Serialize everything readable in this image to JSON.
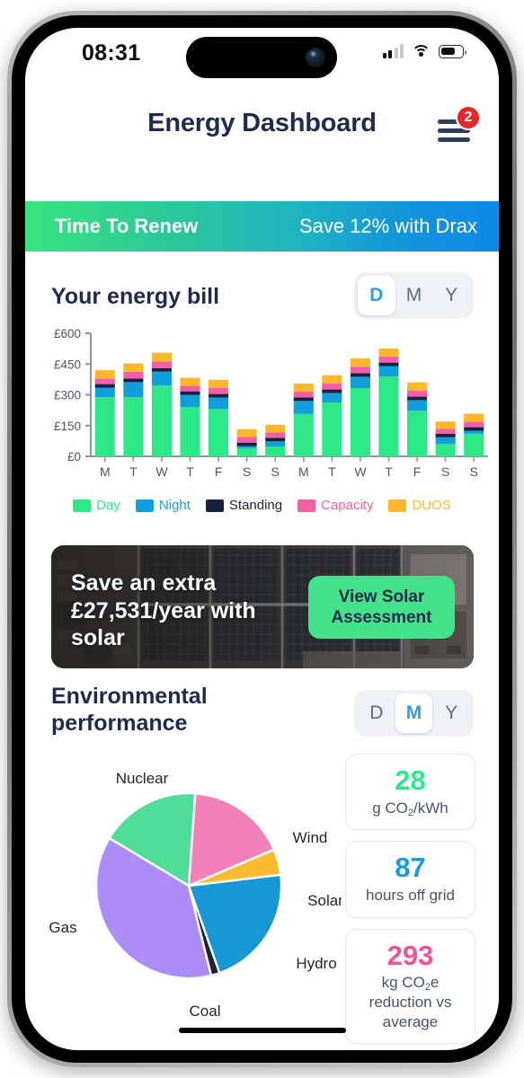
{
  "status_bar": {
    "time": "08:31",
    "signal_icon": "signal-bars-icon",
    "wifi_icon": "wifi-icon",
    "battery_icon": "battery-icon"
  },
  "header": {
    "title": "Energy Dashboard",
    "menu_icon": "hamburger-menu-icon",
    "notification_count": "2",
    "badge_color": "#e8262a"
  },
  "renew_banner": {
    "label": "Time To Renew",
    "offer": "Save 12% with Drax",
    "gradient_from": "#37e57e",
    "gradient_to": "#0c8ae6"
  },
  "bill_section": {
    "title": "Your energy bill",
    "toggle": {
      "options": [
        "D",
        "M",
        "Y"
      ],
      "selected": "D"
    }
  },
  "solar_promo": {
    "headline": "Save an extra £27,531/year with solar",
    "cta_label": "View Solar Assessment",
    "cta_color": "#44e38b"
  },
  "environment_section": {
    "title": "Environmental performance",
    "toggle": {
      "options": [
        "D",
        "M",
        "Y"
      ],
      "selected": "M"
    }
  },
  "metrics": [
    {
      "value": "28",
      "label": "g CO2/kWh",
      "label_pre": "g CO",
      "label_sub": "2",
      "label_post": "/kWh",
      "color": "#2ce887"
    },
    {
      "value": "87",
      "label": "hours off grid",
      "label_pre": "hours off grid",
      "label_sub": "",
      "label_post": "",
      "color": "#1a9ddb"
    },
    {
      "value": "293",
      "label": "kg CO2e reduction vs average",
      "label_pre": "kg CO",
      "label_sub": "2",
      "label_post": "e reduction vs average",
      "color": "#f2529b"
    }
  ],
  "chart_data": [
    {
      "type": "bar",
      "title": "Your energy bill",
      "stacked": true,
      "xlabel": "",
      "ylabel": "",
      "ylim": [
        0,
        600
      ],
      "yticks": [
        0,
        150,
        300,
        450,
        600
      ],
      "ytick_labels": [
        "£0",
        "£150",
        "£300",
        "£450",
        "£600"
      ],
      "grid": false,
      "legend_position": "bottom",
      "categories": [
        "M",
        "T",
        "W",
        "T",
        "F",
        "S",
        "S",
        "M",
        "T",
        "W",
        "T",
        "F",
        "S",
        "S"
      ],
      "series": [
        {
          "name": "Day",
          "color": "#2ce887",
          "values": [
            288,
            288,
            345,
            240,
            232,
            40,
            48,
            207,
            263,
            333,
            390,
            222,
            60,
            110
          ]
        },
        {
          "name": "Night",
          "color": "#119edb",
          "values": [
            47,
            74,
            68,
            60,
            55,
            10,
            25,
            63,
            46,
            55,
            50,
            52,
            33,
            15
          ]
        },
        {
          "name": "Standing",
          "color": "#17233c",
          "values": [
            17,
            17,
            17,
            17,
            17,
            17,
            17,
            17,
            17,
            17,
            17,
            17,
            17,
            17
          ]
        },
        {
          "name": "Capacity",
          "color": "#f65fa8",
          "values": [
            28,
            33,
            33,
            27,
            29,
            27,
            26,
            28,
            30,
            31,
            29,
            30,
            24,
            27
          ]
        },
        {
          "name": "DUOS",
          "color": "#fbb82c",
          "values": [
            40,
            41,
            42,
            39,
            40,
            39,
            38,
            40,
            40,
            42,
            40,
            40,
            36,
            39
          ]
        }
      ]
    },
    {
      "type": "pie",
      "title": "Environmental performance",
      "labels": [
        "Wind",
        "Solar",
        "Hydro",
        "Coal",
        "Gas",
        "Nuclear"
      ],
      "values": [
        17.5,
        4.5,
        21.5,
        1.5,
        37.5,
        17.5
      ],
      "colors": [
        "#f280bb",
        "#fbbb30",
        "#1798d4",
        "#1b2436",
        "#ab8df5",
        "#4fdd98"
      ],
      "label_positions": [
        "right-top",
        "right",
        "right-bottom",
        "bottom",
        "left",
        "top-left"
      ]
    }
  ]
}
